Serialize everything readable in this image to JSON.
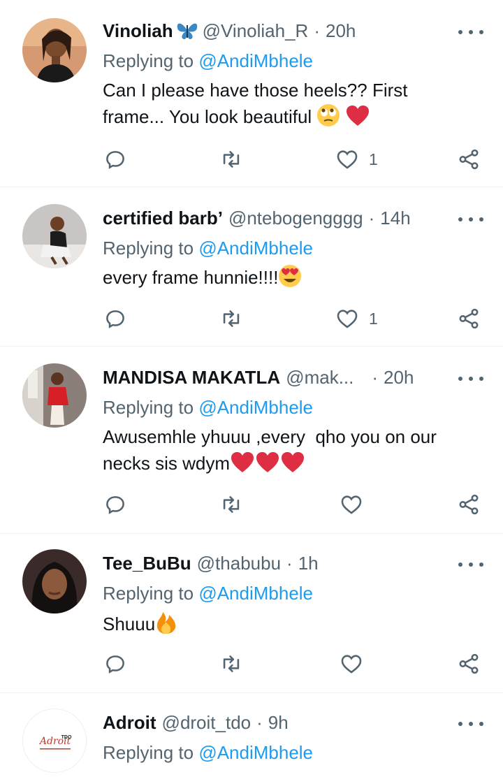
{
  "replying_label": "Replying to",
  "tweets": [
    {
      "name": "Vinoliah",
      "handle": "@Vinoliah_R",
      "time": "20h",
      "mention": "@AndiMbhele",
      "text_lines": [
        "Can I please have those heels?? First",
        "frame... You look beautiful"
      ],
      "text_emoji": [
        "rolling-eyes-emoji",
        "red-heart-emoji"
      ],
      "likes": "1"
    },
    {
      "name": "certified barb’",
      "handle": "@ntebogengggg",
      "time": "14h",
      "mention": "@AndiMbhele",
      "text_lines": [
        "every frame hunnie!!!!"
      ],
      "text_emoji": [
        "heart-eyes-emoji"
      ],
      "likes": "1"
    },
    {
      "name": "MANDISA MAKATLA",
      "handle": "@mak...",
      "time": "20h",
      "mention": "@AndiMbhele",
      "text_lines": [
        "Awusemhle yhuuu ,every  qho you on our",
        "necks sis wdym"
      ],
      "text_emoji": [
        "red-heart-emoji",
        "red-heart-emoji",
        "red-heart-emoji"
      ],
      "likes": ""
    },
    {
      "name": "Tee_BuBu",
      "handle": "@thabubu",
      "time": "1h",
      "mention": "@AndiMbhele",
      "text_lines": [
        "Shuuu"
      ],
      "text_emoji": [
        "fire-emoji"
      ],
      "likes": ""
    },
    {
      "name": "Adroit",
      "handle": "@droit_tdo",
      "time": "9h",
      "mention": "@AndiMbhele",
      "avatar_logo_text": "Adroit TDO",
      "text_lines": [],
      "likes": ""
    }
  ],
  "colors": {
    "text": "#0f1419",
    "muted": "#536471",
    "link": "#1d9bf0",
    "divider": "#eff3f4"
  }
}
